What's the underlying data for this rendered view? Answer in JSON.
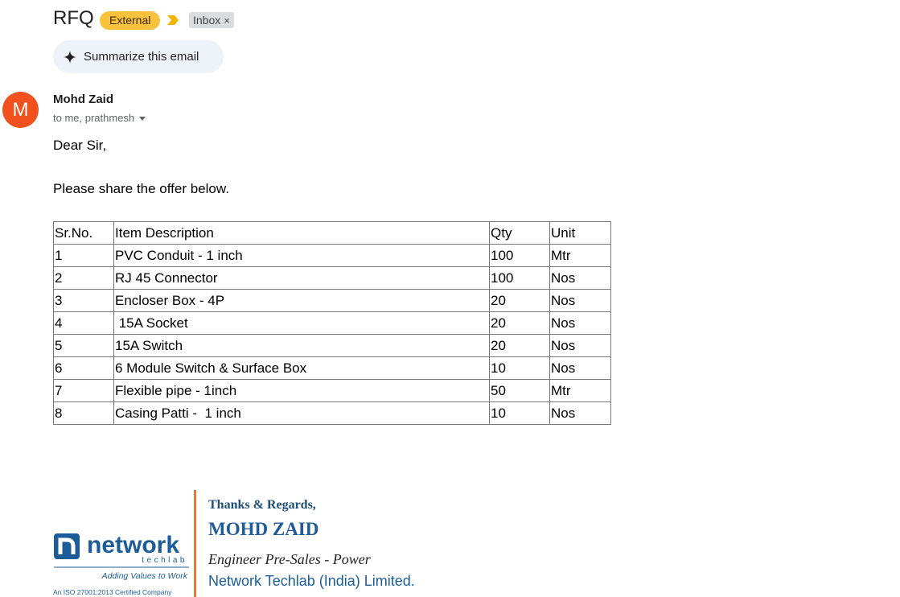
{
  "subject": "RFQ",
  "labels": {
    "external": "External",
    "inbox": "Inbox",
    "inbox_close": "×"
  },
  "summarize_label": "Summarize this email",
  "sender": {
    "avatar_letter": "M",
    "name": "Mohd Zaid",
    "recipients": "to me, prathmesh"
  },
  "body": {
    "greeting": "Dear Sir,",
    "request": "Please share the offer below."
  },
  "table": {
    "headers": [
      "Sr.No.",
      "Item Description",
      "Qty",
      "Unit"
    ],
    "rows": [
      [
        "1",
        "PVC Conduit - 1 inch",
        "100",
        "Mtr"
      ],
      [
        "2",
        "RJ 45 Connector",
        "100",
        "Nos"
      ],
      [
        "3",
        "Encloser Box - 4P",
        "20",
        "Nos"
      ],
      [
        "4",
        " 15A Socket",
        "20",
        "Nos"
      ],
      [
        "5",
        "15A Switch",
        "20",
        "Nos"
      ],
      [
        "6",
        "6 Module Switch & Surface Box",
        "10",
        "Nos"
      ],
      [
        "7",
        "Flexible pipe - 1inch",
        "50",
        "Mtr"
      ],
      [
        "8",
        "Casing Patti -  1 inch",
        "10",
        "Nos"
      ]
    ]
  },
  "signature": {
    "regards": "Thanks & Regards,",
    "name": "MOHD ZAID",
    "title": "Engineer Pre-Sales - Power",
    "company": "Network Techlab (India) Limited.",
    "logo": {
      "word": "network",
      "sub": "techlab",
      "tagline": "Adding Values to Work",
      "cert": "An ISO 27001:2013 Certified Company"
    }
  },
  "colors": {
    "external_badge": "#f9c23c",
    "avatar": "#f0511d",
    "signature_bar": "#e07b39",
    "brand_blue": "#1f5a99"
  }
}
